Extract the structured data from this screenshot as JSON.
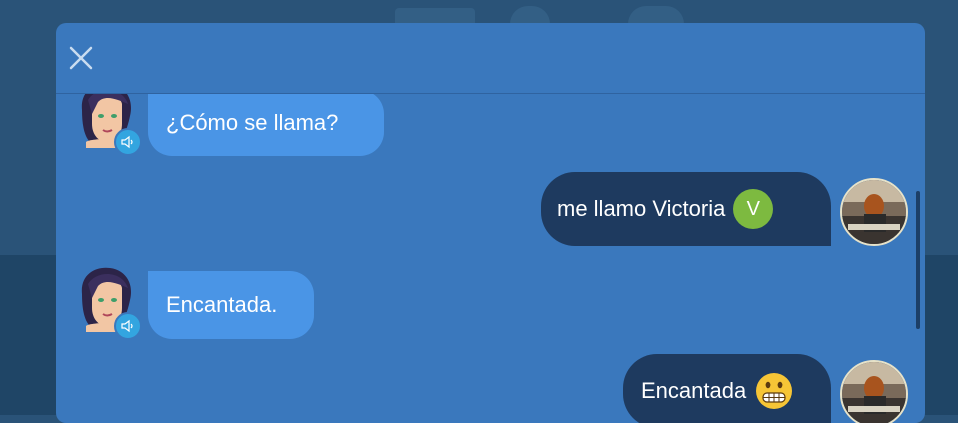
{
  "app": {
    "accent": "#3a78bd"
  },
  "dialog": {
    "close_icon": "close-icon"
  },
  "messages": [
    {
      "sender": "tutor",
      "text": "¿Cómo se llama?",
      "icons": [
        "tutor-avatar-icon",
        "speaker-icon"
      ]
    },
    {
      "sender": "user",
      "text": "me llamo Victoria",
      "badge": "V",
      "icons": [
        "user-avatar"
      ]
    },
    {
      "sender": "tutor",
      "text": "Encantada.",
      "icons": [
        "tutor-avatar-icon",
        "speaker-icon"
      ]
    },
    {
      "sender": "user",
      "text": "Encantada",
      "icons": [
        "grimacing-face-emoji-icon",
        "user-avatar"
      ]
    }
  ],
  "colors": {
    "tutor_bubble": "#4a95e6",
    "user_bubble": "#1e3a5f",
    "badge": "#7dba40",
    "speaker": "#33a5e0"
  }
}
